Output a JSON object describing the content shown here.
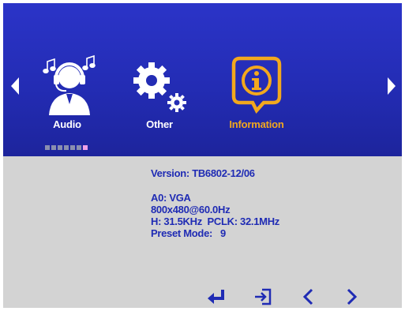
{
  "menu": {
    "items": [
      {
        "label": "Audio",
        "icon": "headset-person-icon"
      },
      {
        "label": "Other",
        "icon": "gears-icon"
      },
      {
        "label": "Information",
        "icon": "info-bubble-icon",
        "selected": true
      }
    ],
    "page_indicator": {
      "total": 6,
      "active": 6
    }
  },
  "info": {
    "version": "Version: TB6802-12/06",
    "input": "A0: VGA",
    "resolution": "800x480@60.0Hz",
    "timing": "H: 31.5KHz  PCLK: 32.1MHz",
    "preset": "Preset Mode:   9"
  },
  "footer": {
    "buttons": [
      "enter-icon",
      "exit-icon",
      "left-icon",
      "right-icon"
    ]
  },
  "colors": {
    "header_blue": "#232cb4",
    "panel_gray": "#d3d3d3",
    "selected_orange": "#f2a81e",
    "text_blue": "#1f2bb4"
  }
}
